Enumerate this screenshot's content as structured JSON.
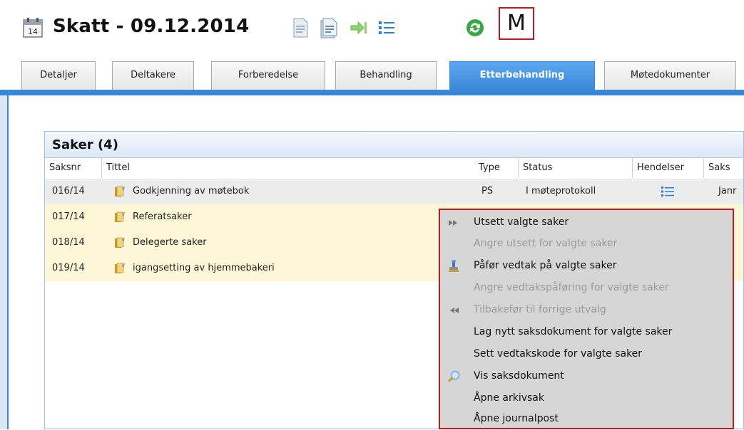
{
  "header": {
    "calendar_day": "14",
    "title": "Skatt - 09.12.2014",
    "m_button": "M"
  },
  "tabs": [
    {
      "label": "Detaljer"
    },
    {
      "label": "Deltakere"
    },
    {
      "label": "Forberedelse"
    },
    {
      "label": "Behandling"
    },
    {
      "label": "Etterbehandling",
      "active": true
    },
    {
      "label": "Møtedokumenter"
    }
  ],
  "panel": {
    "title": "Saker (4)",
    "columns": [
      "Saksnr",
      "Tittel",
      "Type",
      "Status",
      "Hendelser",
      "Saks"
    ],
    "rows": [
      {
        "saksnr": "016/14",
        "tittel": "Godkjenning av møtebok",
        "type": "PS",
        "status": "I møteprotokoll",
        "saks": "Janr"
      },
      {
        "saksnr": "017/14",
        "tittel": "Referatsaker",
        "type": "",
        "status": "",
        "saks": ""
      },
      {
        "saksnr": "018/14",
        "tittel": "Delegerte saker",
        "type": "",
        "status": "",
        "saks": ""
      },
      {
        "saksnr": "019/14",
        "tittel": "igangsetting av hjemmebakeri",
        "type": "",
        "status": "",
        "saks": ""
      }
    ]
  },
  "context_menu": {
    "items": [
      {
        "label": "Utsett valgte saker",
        "enabled": true,
        "icon": "fast-forward-icon"
      },
      {
        "label": "Angre utsett for valgte saker",
        "enabled": false,
        "icon": ""
      },
      {
        "label": "Påfør vedtak på valgte saker",
        "enabled": true,
        "icon": "stamp-icon"
      },
      {
        "label": "Angre vedtakspåføring for valgte saker",
        "enabled": false,
        "icon": ""
      },
      {
        "label": "Tilbakefør til forrige utvalg",
        "enabled": false,
        "icon": "rewind-icon"
      },
      {
        "label": "Lag nytt saksdokument for valgte saker",
        "enabled": true,
        "icon": ""
      },
      {
        "label": "Sett vedtakskode for valgte saker",
        "enabled": true,
        "icon": ""
      },
      {
        "label": "Vis saksdokument",
        "enabled": true,
        "icon": "magnifier-icon"
      },
      {
        "label": "Åpne arkivsak",
        "enabled": true,
        "icon": ""
      },
      {
        "label": "Åpne journalpost",
        "enabled": true,
        "icon": ""
      }
    ]
  },
  "colors": {
    "accent_blue": "#3a86d8",
    "highlight_red": "#c0191d",
    "row_yellow": "#fdf7d8",
    "menu_bg": "#d6d6d6"
  }
}
